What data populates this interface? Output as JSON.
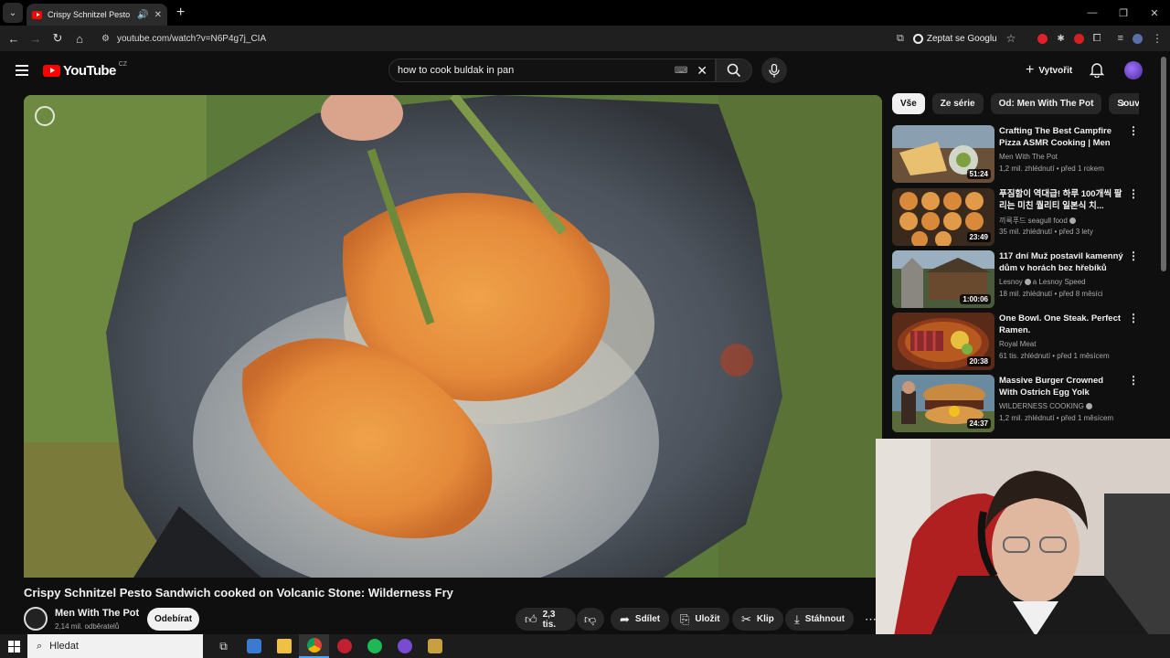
{
  "browser": {
    "tab_title": "Crispy Schnitzel Pesto Sandw",
    "url": "youtube.com/watch?v=N6P4g7j_CIA",
    "google_button": "Zeptat se Googlu"
  },
  "header": {
    "logo_text": "YouTube",
    "region": "CZ",
    "search_query": "how to cook buldak in pan",
    "create_label": "Vytvořit"
  },
  "video": {
    "title": "Crispy Schnitzel Pesto Sandwich cooked on Volcanic Stone: Wilderness Fry",
    "channel": "Men With The Pot",
    "subscribers": "2,14 mil. odběratelů",
    "subscribe_label": "Odebírat",
    "likes": "2,3 tis.",
    "share_label": "Sdílet",
    "save_label": "Uložit",
    "clip_label": "Klip",
    "download_label": "Stáhnout"
  },
  "chips": [
    "Vše",
    "Ze série",
    "Od: Men With The Pot",
    "Souv"
  ],
  "recommendations": [
    {
      "title": "Crafting The Best Campfire Pizza ASMR Cooking | Men Wi...",
      "channel": "Men With The Pot",
      "meta": "1,2 mil. zhlédnutí • před 1 rokem",
      "duration": "51:24",
      "verified": false
    },
    {
      "title": "푸짐함이 역대급! 하루 100개씩 팔리는 미친 퀄리티 일본식 치...",
      "channel": "끼룩푸드 seagull food",
      "meta": "35 mil. zhlédnutí • před 3 lety",
      "duration": "23:49",
      "verified": true
    },
    {
      "title": "117 dní Muž postavil kamenný dům v horách bez hřebíků",
      "channel": "Lesnoy",
      "channel_extra": "a Lesnoy Speed",
      "meta": "18 mil. zhlédnutí • před 8 měsíci",
      "duration": "1:00:06",
      "verified": true
    },
    {
      "title": "One Bowl. One Steak. Perfect Ramen.",
      "channel": "Royal Meat",
      "meta": "61 tis. zhlédnutí • před 1 měsícem",
      "duration": "20:38",
      "verified": false
    },
    {
      "title": "Massive Burger Crowned With Ostrich Egg Yolk",
      "channel": "WILDERNESS COOKING",
      "meta": "1,2 mil. zhlédnutí • před 1 měsícem",
      "duration": "24:37",
      "verified": true
    }
  ],
  "taskbar": {
    "search_placeholder": "Hledat"
  },
  "colors": {
    "background": "#0f0f0f",
    "brand_red": "#ff0000",
    "chip_active": "#f1f1f1",
    "button_bg": "#272727"
  }
}
